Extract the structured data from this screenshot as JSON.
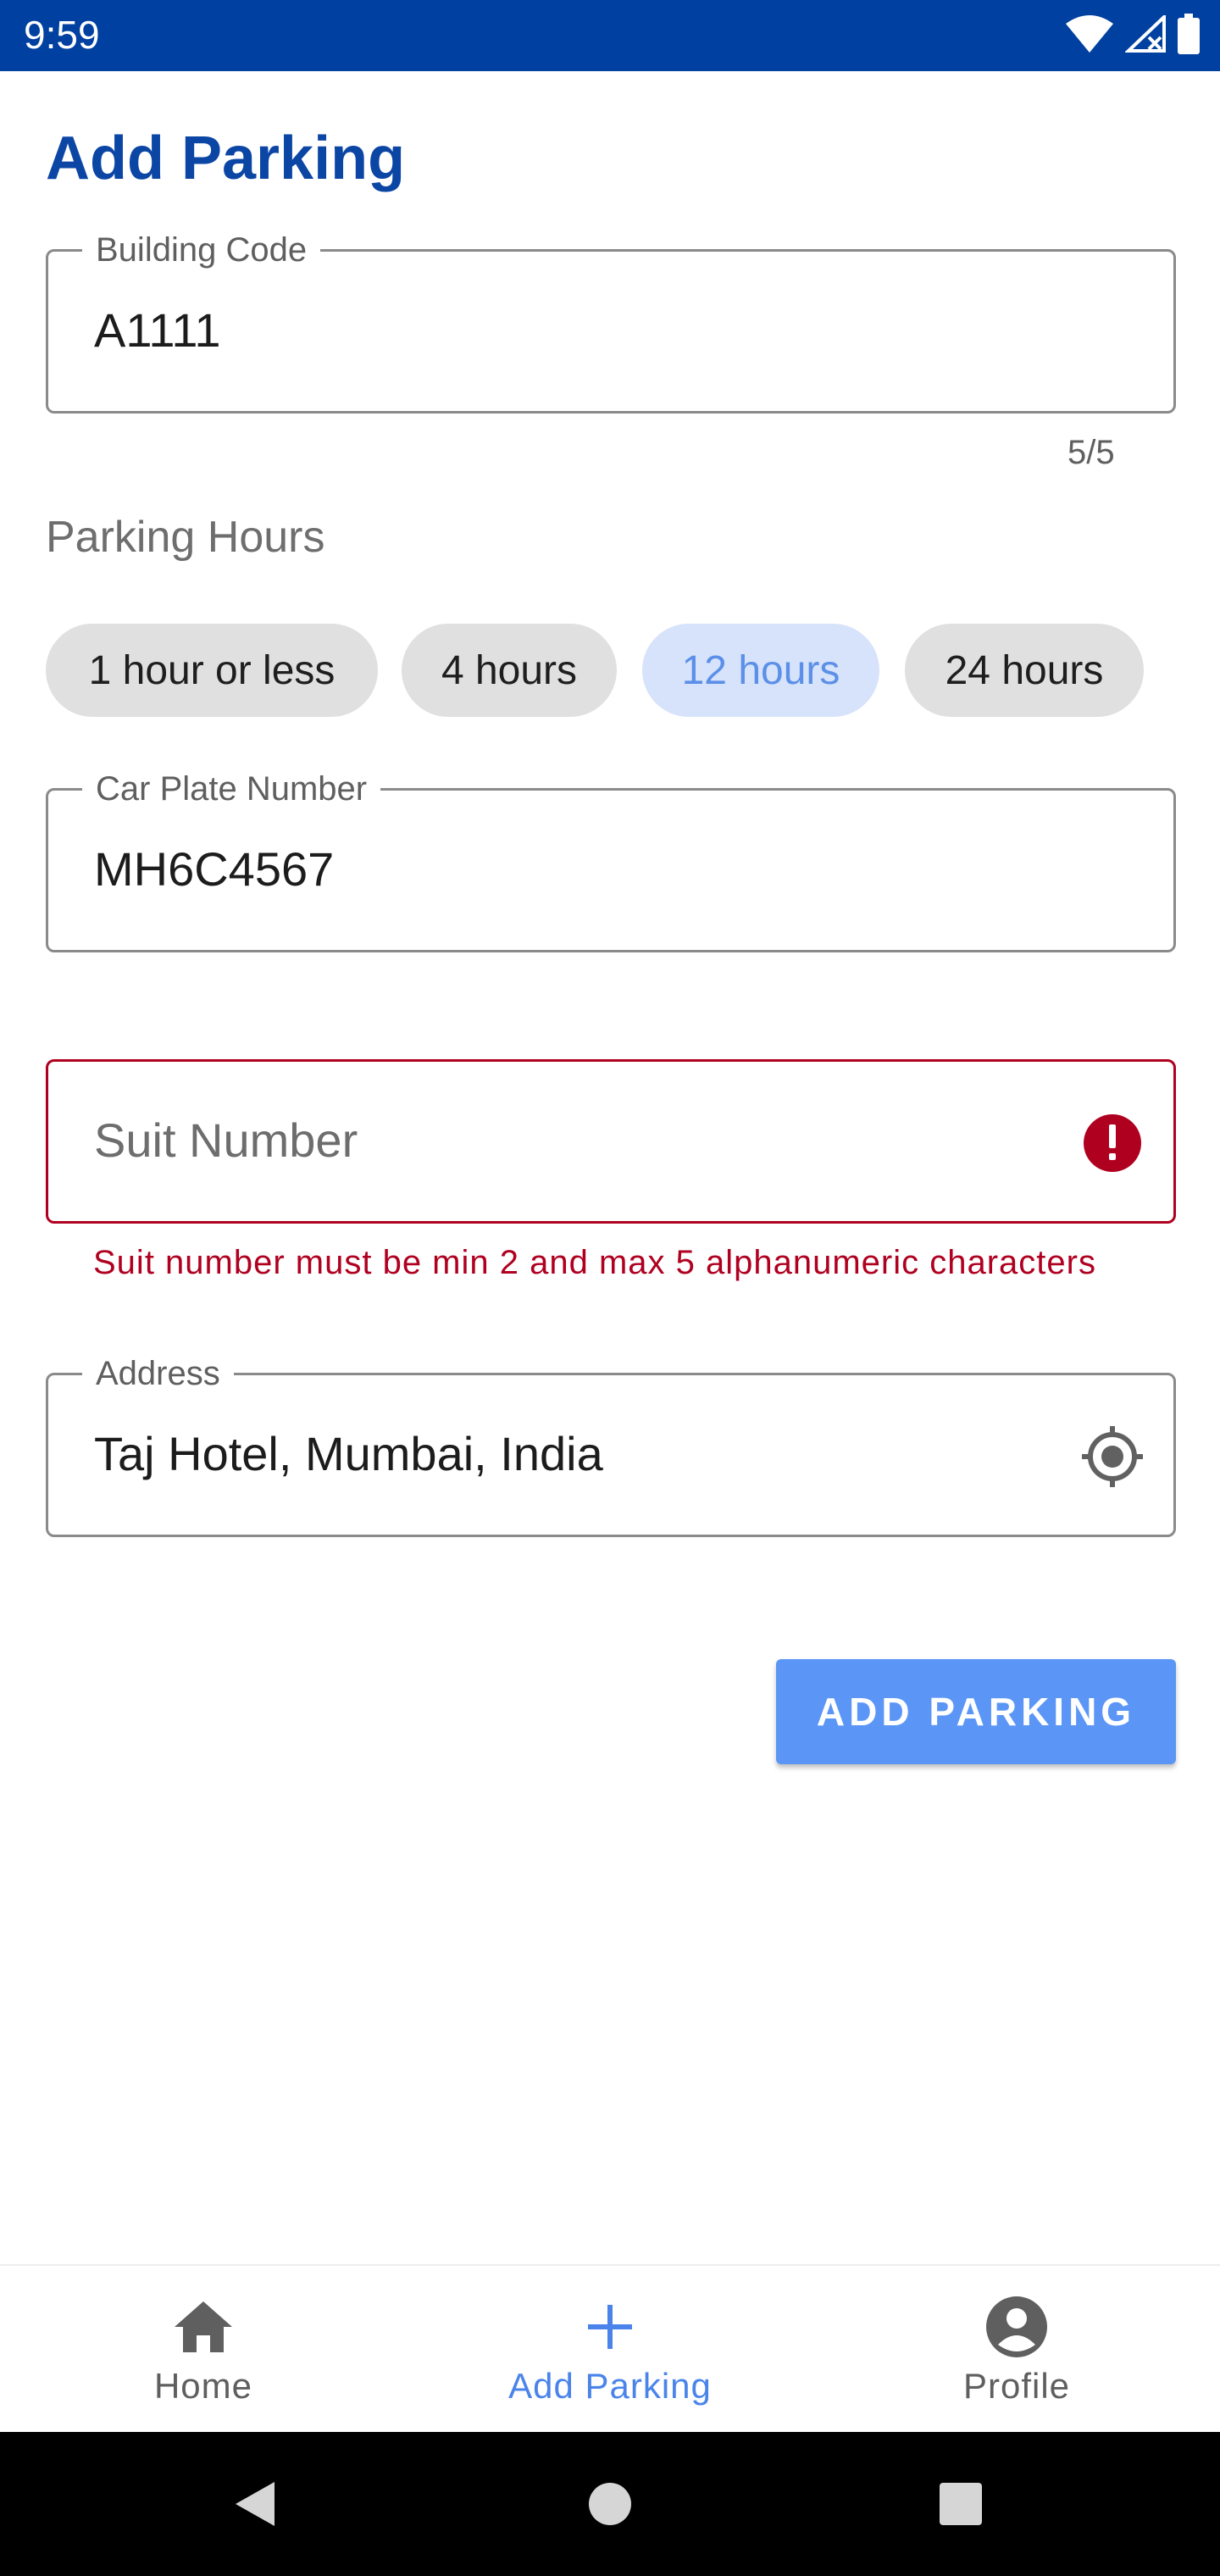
{
  "status_bar": {
    "time": "9:59",
    "icons": [
      "wifi-icon",
      "signal-no-service-icon",
      "battery-icon"
    ]
  },
  "page": {
    "title": "Add Parking"
  },
  "building_code": {
    "label": "Building Code",
    "value": "A1111",
    "counter": "5/5"
  },
  "parking_hours": {
    "label": "Parking Hours",
    "options": [
      "1 hour or less",
      "4 hours",
      "12 hours",
      "24 hours"
    ],
    "selected": "12 hours"
  },
  "car_plate": {
    "label": "Car Plate Number",
    "value": "MH6C4567"
  },
  "suit_number": {
    "placeholder": "Suit Number",
    "value": "",
    "error": "Suit number must be min 2 and max 5 alphanumeric characters",
    "trailing_icon": "error-icon"
  },
  "address": {
    "label": "Address",
    "value": "Taj Hotel, Mumbai, India",
    "trailing_icon": "my-location-icon"
  },
  "actions": {
    "add_parking": "ADD PARKING"
  },
  "bottom_nav": {
    "items": [
      {
        "label": "Home",
        "icon": "home-icon"
      },
      {
        "label": "Add Parking",
        "icon": "add-icon"
      },
      {
        "label": "Profile",
        "icon": "account-circle-icon"
      }
    ],
    "active": "Add Parking"
  },
  "colors": {
    "primary": "#0040a0",
    "accent": "#5b96f7",
    "error": "#b00020"
  }
}
